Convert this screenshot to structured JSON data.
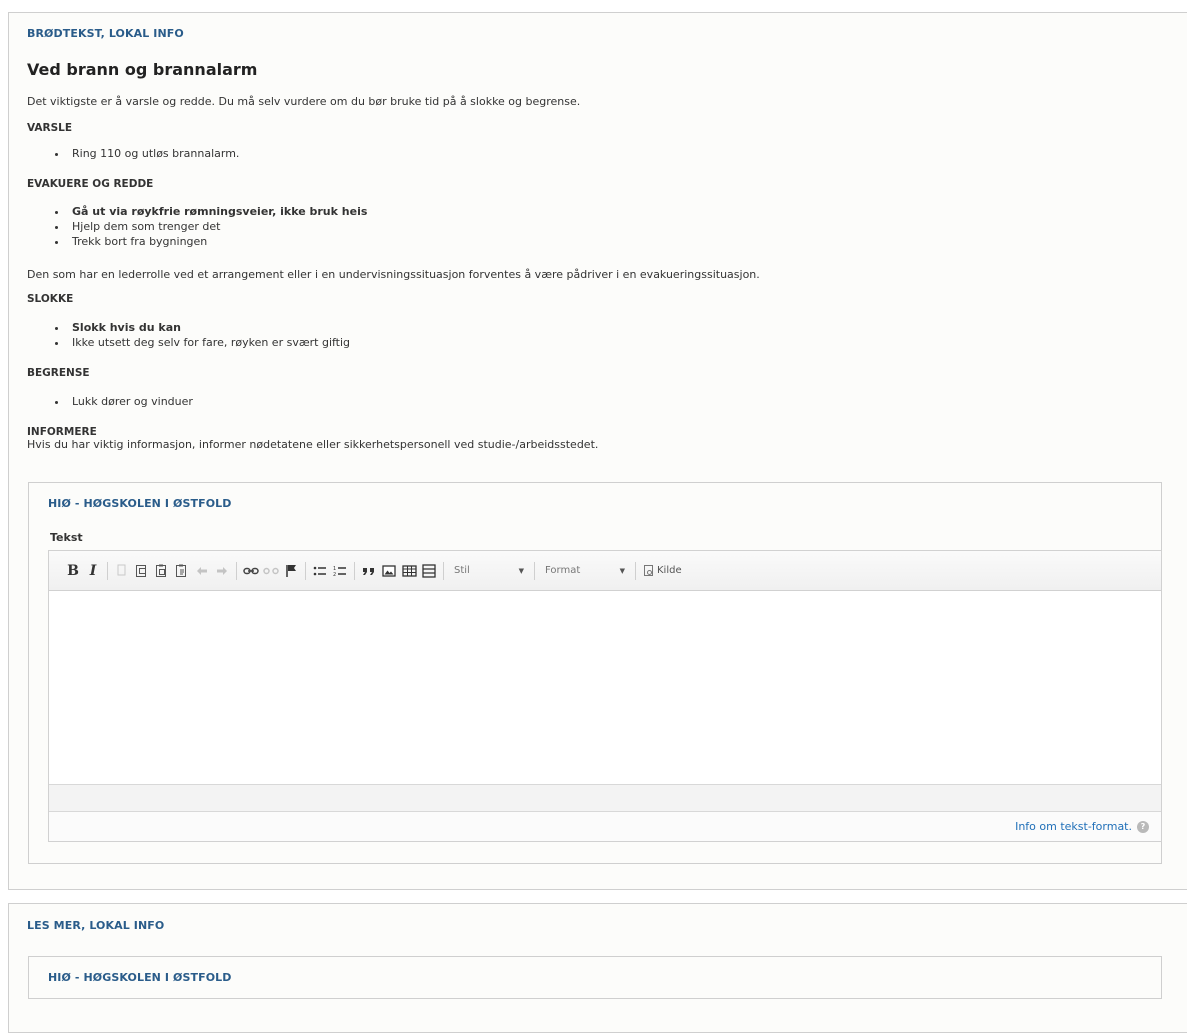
{
  "body_panel": {
    "legend": "BRØDTEKST, LOKAL INFO",
    "title": "Ved brann og brannalarm",
    "intro": "Det viktigste er å varsle og redde. Du må selv vurdere om du bør bruke tid på å slokke og begrense.",
    "sections": [
      {
        "heading": "VARSLE",
        "items": [
          "Ring 110 og utløs brannalarm."
        ]
      },
      {
        "heading": "EVAKUERE OG REDDE",
        "items": [
          "Gå ut via røykfrie rømningsveier, ikke bruk heis",
          "Hjelp dem som trenger det",
          "Trekk bort fra bygningen"
        ]
      },
      {
        "heading": "SLOKKE",
        "items": [
          "Slokk hvis du kan",
          "Ikke utsett deg selv for fare, røyken er svært giftig"
        ]
      },
      {
        "heading": "BEGRENSE",
        "items": [
          "Lukk dører og vinduer"
        ]
      }
    ],
    "leader_note": "Den som har en lederrolle ved et arrangement eller i en undervisningssituasjon forventes å være pådriver i en evakueringssituasjon.",
    "inform_heading": "INFORMERE",
    "inform_text": "Hvis du har viktig informasjon, informer nødetatene eller sikkerhetspersonell ved studie-/arbeidsstedet.",
    "institution": {
      "legend": "HIØ - HØGSKOLEN I ØSTFOLD",
      "field_label": "Tekst",
      "editor": {
        "toolbar": {
          "bold": "B",
          "italic": "I",
          "style_combo": "Stil",
          "format_combo": "Format",
          "source_label": "Kilde"
        },
        "body_value": "",
        "info_link": "Info om tekst-format.",
        "help_glyph": "?"
      }
    }
  },
  "read_more_panel": {
    "legend": "LES MER, LOKAL INFO",
    "institution_legend": "HIØ - HØGSKOLEN I ØSTFOLD"
  }
}
